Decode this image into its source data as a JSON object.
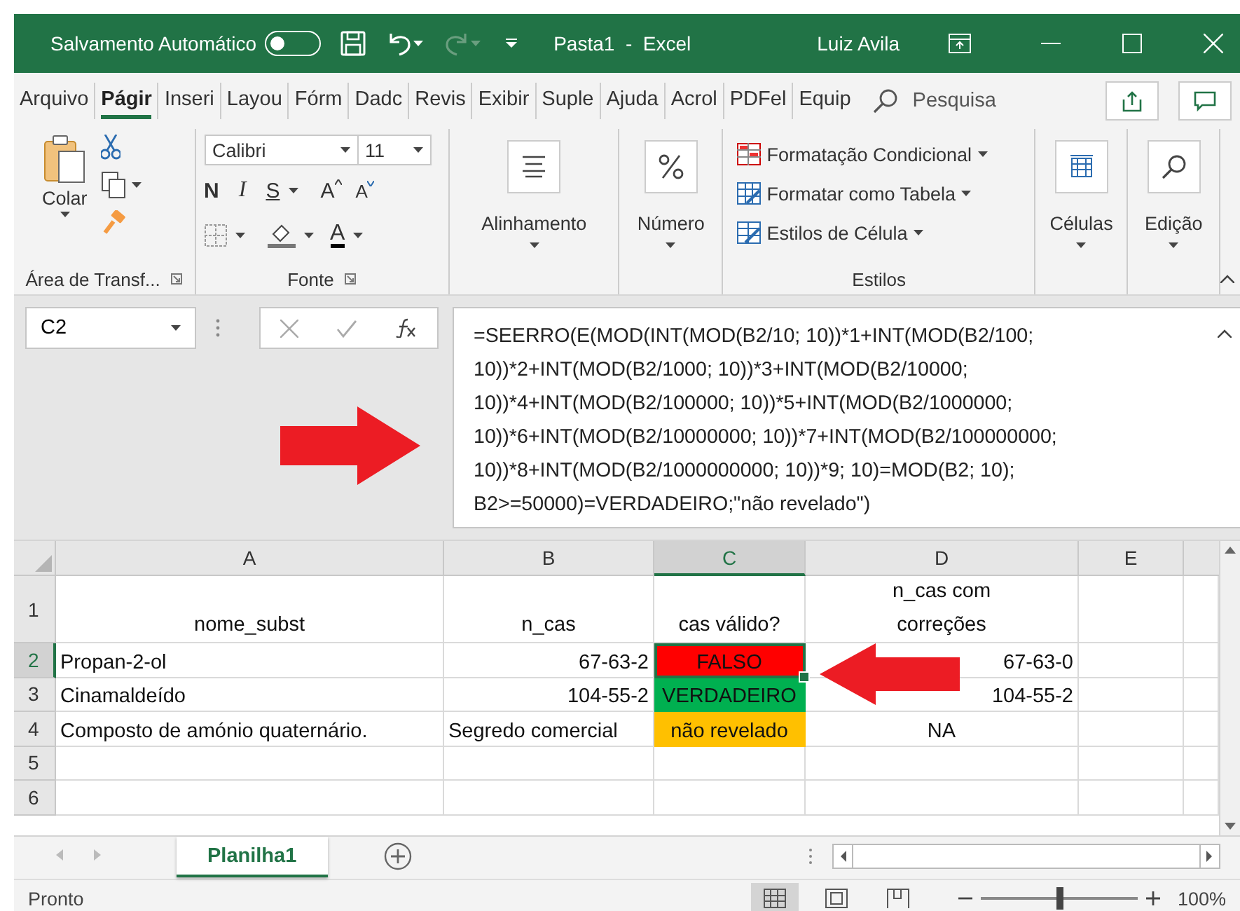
{
  "title_bar": {
    "autosave_label": "Salvamento Automático",
    "autosave_on": false,
    "document_title": "Pasta1  -  Excel",
    "user": "Luiz Avila"
  },
  "ribbon_tabs": [
    {
      "label": "Arquivo",
      "selected": false
    },
    {
      "label": "Págir",
      "selected": true
    },
    {
      "label": "Inseri",
      "selected": false
    },
    {
      "label": "Layou",
      "selected": false
    },
    {
      "label": "Fórm",
      "selected": false
    },
    {
      "label": "Dadc",
      "selected": false
    },
    {
      "label": "Revis",
      "selected": false
    },
    {
      "label": "Exibir",
      "selected": false
    },
    {
      "label": "Suple",
      "selected": false
    },
    {
      "label": "Ajuda",
      "selected": false
    },
    {
      "label": "Acrol",
      "selected": false
    },
    {
      "label": "PDFel",
      "selected": false
    },
    {
      "label": "Equip",
      "selected": false
    }
  ],
  "search": {
    "placeholder": "Pesquisa"
  },
  "ribbon": {
    "clipboard": {
      "paste_label": "Colar",
      "group_label": "Área de Transf..."
    },
    "font": {
      "name": "Calibri",
      "size": "11",
      "bold": "N",
      "italic": "I",
      "underline": "S",
      "grow": "A",
      "shrink": "A",
      "font_color": "A",
      "group_label": "Fonte"
    },
    "alignment_label": "Alinhamento",
    "number_label": "Número",
    "styles": {
      "items": [
        "Formatação Condicional",
        "Formatar como Tabela",
        "Estilos de Célula"
      ],
      "group_label": "Estilos"
    },
    "cells_label": "Células",
    "editing_label": "Edição"
  },
  "formula_bar": {
    "name_box": "C2",
    "formula": "=SEERRO(E(MOD(INT(MOD(B2/10; 10))*1+INT(MOD(B2/100; 10))*2+INT(MOD(B2/1000; 10))*3+INT(MOD(B2/10000; 10))*4+INT(MOD(B2/100000; 10))*5+INT(MOD(B2/1000000; 10))*6+INT(MOD(B2/10000000; 10))*7+INT(MOD(B2/100000000; 10))*8+INT(MOD(B2/1000000000; 10))*9; 10)=MOD(B2; 10); B2>=50000)=VERDADEIRO;\"não revelado\")"
  },
  "grid": {
    "columns": [
      {
        "label": "A",
        "selected": false
      },
      {
        "label": "B",
        "selected": false
      },
      {
        "label": "C",
        "selected": true
      },
      {
        "label": "D",
        "selected": false
      },
      {
        "label": "E",
        "selected": false
      }
    ],
    "rows": [
      {
        "label": "1",
        "selected": false,
        "cells": [
          {
            "text": "nome_subst",
            "kind": "heading",
            "selected": false
          },
          {
            "text": "n_cas",
            "kind": "heading",
            "selected": false
          },
          {
            "text": "cas válido?",
            "kind": "heading",
            "selected": false
          },
          {
            "text": "n_cas com correções",
            "kind": "heading",
            "selected": false
          }
        ]
      },
      {
        "label": "2",
        "selected": true,
        "cells": [
          {
            "text": "Propan-2-ol",
            "kind": "text",
            "selected": false
          },
          {
            "text": "67-63-2",
            "kind": "number",
            "selected": false
          },
          {
            "text": "FALSO",
            "kind": "boolean",
            "color": "#ff0000",
            "selected": true
          },
          {
            "text": "67-63-0",
            "kind": "number",
            "selected": false
          }
        ]
      },
      {
        "label": "3",
        "selected": false,
        "cells": [
          {
            "text": "Cinamaldeído",
            "kind": "text",
            "selected": false
          },
          {
            "text": "104-55-2",
            "kind": "number",
            "selected": false
          },
          {
            "text": "VERDADEIRO",
            "kind": "boolean",
            "color": "#00b050",
            "selected": false
          },
          {
            "text": "104-55-2",
            "kind": "number",
            "selected": false
          }
        ]
      },
      {
        "label": "4",
        "selected": false,
        "cells": [
          {
            "text": "Composto de amónio quaternário.",
            "kind": "text",
            "selected": false
          },
          {
            "text": "Segredo comercial",
            "kind": "text",
            "selected": false
          },
          {
            "text": "não revelado",
            "kind": "boolean",
            "color": "#ffc000",
            "selected": false
          },
          {
            "text": "NA",
            "kind": "boolean",
            "selected": false
          }
        ]
      },
      {
        "label": "5",
        "selected": false
      },
      {
        "label": "6",
        "selected": false
      }
    ]
  },
  "sheet_tabs": [
    {
      "label": "Planilha1",
      "selected": true
    }
  ],
  "status_bar": {
    "status": "Pronto",
    "views": [
      {
        "selected": true
      },
      {
        "selected": false
      },
      {
        "selected": false
      }
    ],
    "zoom": {
      "level": 0.5
    },
    "zoom_label": "100%"
  }
}
